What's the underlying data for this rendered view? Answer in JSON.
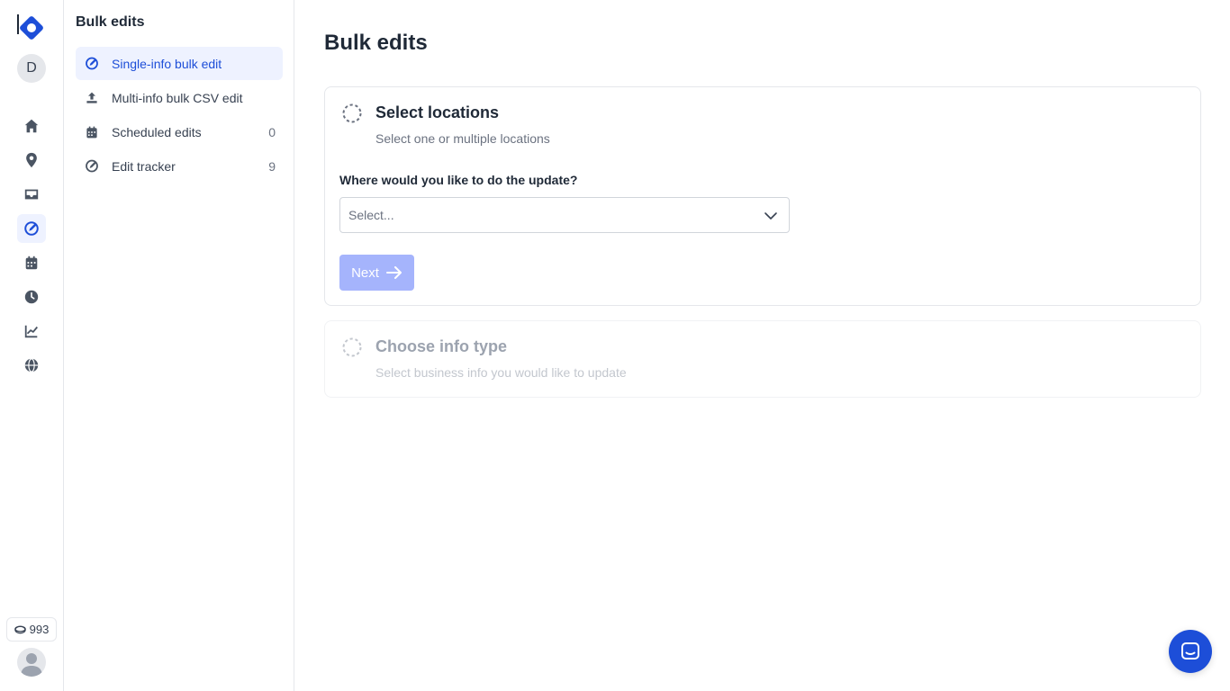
{
  "colors": {
    "accent": "#1d4ed8",
    "accent_light": "#eef2ff",
    "button_disabled": "#a5b4fc",
    "icon_gray": "#4b5563"
  },
  "rail": {
    "avatar_initial": "D",
    "credits": "993",
    "nav_icons": [
      "home-icon",
      "location-pin-icon",
      "inbox-icon",
      "bulk-edit-icon",
      "calendar-icon",
      "clock-icon",
      "chart-icon",
      "globe-icon"
    ],
    "active_icon": "bulk-edit-icon"
  },
  "subnav": {
    "title": "Bulk edits",
    "items": [
      {
        "label": "Single-info bulk edit",
        "icon": "bulk-edit-icon",
        "count": "",
        "active": true
      },
      {
        "label": "Multi-info bulk CSV edit",
        "icon": "upload-icon",
        "count": "",
        "active": false
      },
      {
        "label": "Scheduled edits",
        "icon": "calendar-icon",
        "count": "0",
        "active": false
      },
      {
        "label": "Edit tracker",
        "icon": "tracker-icon",
        "count": "9",
        "active": false
      }
    ]
  },
  "main": {
    "title": "Bulk edits",
    "step1": {
      "title": "Select locations",
      "subtitle": "Select one or multiple locations",
      "question": "Where would you like to do the update?",
      "select_placeholder": "Select...",
      "next_label": "Next"
    },
    "step2": {
      "title": "Choose info type",
      "subtitle": "Select business info you would like to update"
    }
  }
}
